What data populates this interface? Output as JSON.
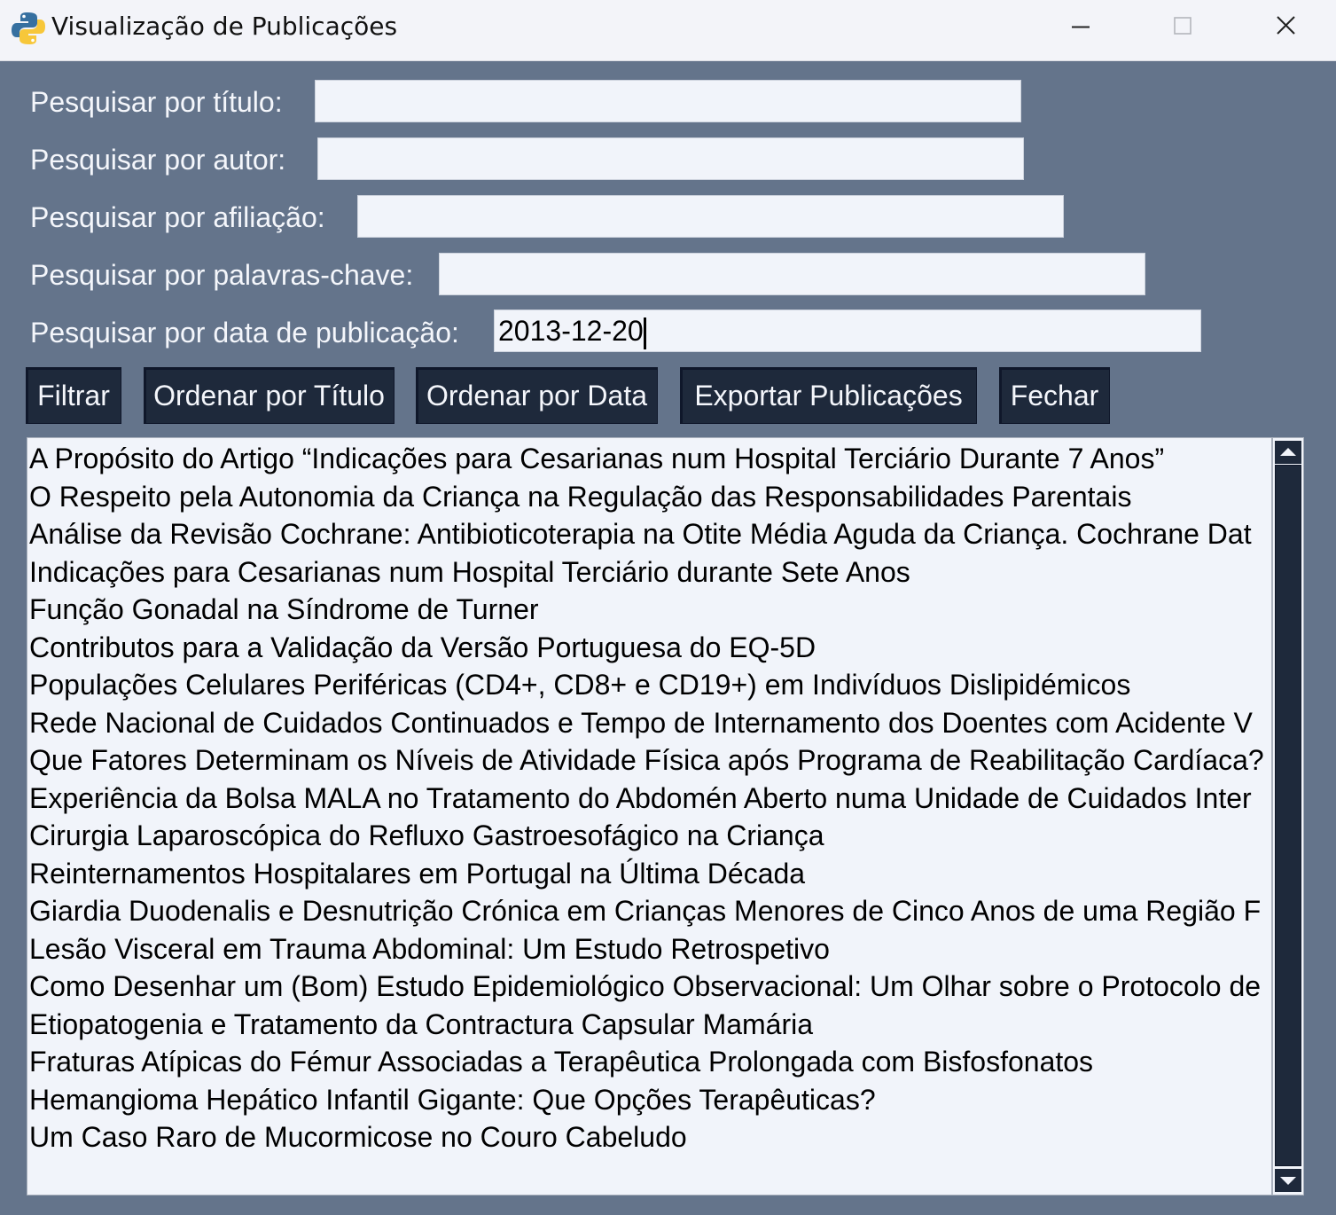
{
  "window": {
    "title": "Visualização de Publicações"
  },
  "search": {
    "title_label": "Pesquisar por título:",
    "title_value": "",
    "author_label": "Pesquisar por autor:",
    "author_value": "",
    "affiliation_label": "Pesquisar por afiliação:",
    "affiliation_value": "",
    "keywords_label": "Pesquisar por palavras-chave:",
    "keywords_value": "",
    "date_label": "Pesquisar por data de publicação:",
    "date_value": "2013-12-20"
  },
  "buttons": {
    "filter": "Filtrar",
    "sort_title": "Ordenar por Título",
    "sort_date": "Ordenar por Data",
    "export": "Exportar Publicações",
    "close": "Fechar"
  },
  "publications": [
    "A Propósito do Artigo “Indicações para Cesarianas num Hospital Terciário Durante 7 Anos”",
    "O Respeito pela Autonomia da Criança na Regulação das Responsabilidades Parentais",
    "Análise da Revisão Cochrane: Antibioticoterapia na Otite Média Aguda da Criança. Cochrane Dat",
    "Indicações para Cesarianas num Hospital Terciário durante Sete Anos",
    "Função Gonadal na Síndrome de Turner",
    "Contributos para a Validação da Versão Portuguesa do EQ-5D",
    "Populações Celulares Periféricas (CD4+, CD8+ e CD19+) em Indivíduos Dislipidémicos",
    "Rede Nacional de Cuidados Continuados e Tempo de Internamento dos Doentes com Acidente V",
    "Que Fatores Determinam os Níveis de Atividade Física após Programa de Reabilitação Cardíaca?",
    "Experiência da Bolsa MALA no Tratamento do Abdomén Aberto numa Unidade de Cuidados Inter",
    "Cirurgia Laparoscópica do Refluxo Gastroesofágico na Criança",
    "Reinternamentos Hospitalares em Portugal na Última Década",
    "Giardia Duodenalis e Desnutrição Crónica em Crianças Menores de Cinco Anos de uma Região F",
    "Lesão Visceral em Trauma Abdominal: Um Estudo Retrospetivo",
    "Como Desenhar um (Bom) Estudo Epidemiológico Observacional: Um Olhar sobre o Protocolo de",
    "Etiopatogenia e Tratamento da Contractura Capsular Mamária",
    "Fraturas Atípicas do Fémur Associadas a Terapêutica Prolongada com Bisfosfonatos",
    "Hemangioma Hepático Infantil Gigante: Que Opções Terapêuticas?",
    "Um Caso Raro de Mucormicose no Couro Cabeludo"
  ],
  "icons": {
    "app": "python-logo-icon",
    "minimize": "minimize-icon",
    "maximize": "maximize-icon",
    "close": "close-icon",
    "scroll_up": "arrow-up-icon",
    "scroll_down": "arrow-down-icon"
  },
  "colors": {
    "background": "#64748b",
    "button": "#1e293b",
    "field": "#f1f4fa",
    "label_text": "#f4f6fb"
  }
}
